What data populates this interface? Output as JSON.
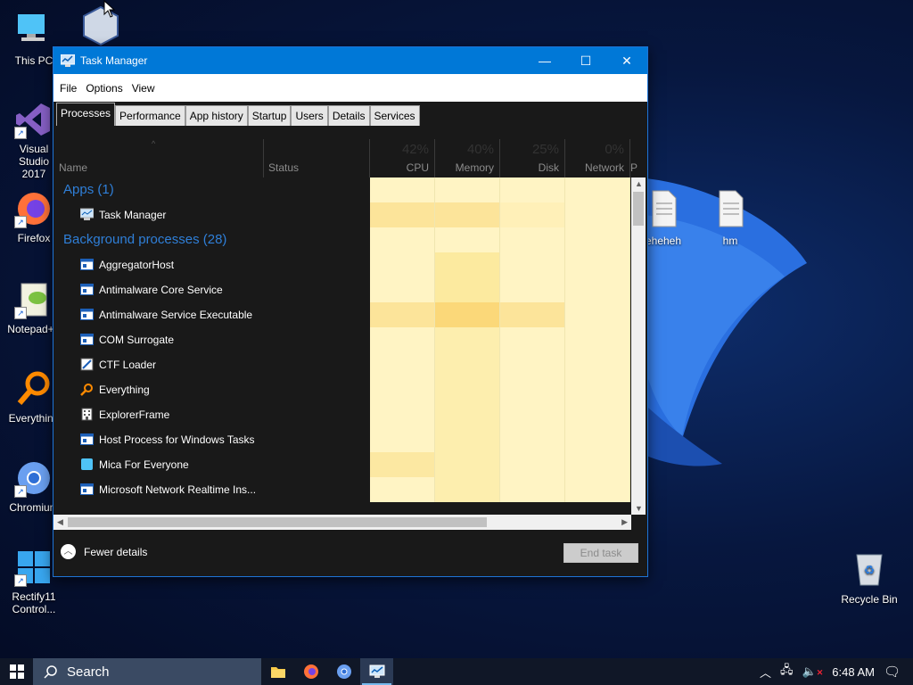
{
  "desktop": {
    "icons_left": [
      {
        "label": "This PC",
        "icon": "computer-icon"
      },
      {
        "label": "Visual Studio 2017",
        "icon": "visual-studio-icon"
      },
      {
        "label": "Firefox",
        "icon": "firefox-icon"
      },
      {
        "label": "Notepad++",
        "icon": "notepad-plus-icon"
      },
      {
        "label": "Everything",
        "icon": "everything-search-icon"
      },
      {
        "label": "Chromium",
        "icon": "chromium-icon"
      },
      {
        "label": "Rectify11 Control...",
        "icon": "windows-logo-icon"
      }
    ],
    "icons_right": [
      {
        "label": "eheheh",
        "icon": "text-file-icon"
      },
      {
        "label": "hm",
        "icon": "text-file-icon"
      },
      {
        "label": "Recycle Bin",
        "icon": "recycle-bin-icon"
      }
    ],
    "colors": {
      "wallpaper": "#07173f",
      "bloom": "#2a6fe0"
    }
  },
  "window": {
    "title": "Task Manager",
    "controls": {
      "minimize": "—",
      "maximize": "☐",
      "close": "✕"
    },
    "menu": [
      "File",
      "Options",
      "View"
    ],
    "tabs": [
      "Processes",
      "Performance",
      "App history",
      "Startup",
      "Users",
      "Details",
      "Services"
    ],
    "active_tab": "Processes",
    "columns": {
      "name": "Name",
      "status": "Status",
      "cpu": {
        "label": "CPU",
        "pct": "42%"
      },
      "memory": {
        "label": "Memory",
        "pct": "40%"
      },
      "disk": {
        "label": "Disk",
        "pct": "25%"
      },
      "network": {
        "label": "Network",
        "pct": "0%"
      },
      "power": "P"
    },
    "groups": {
      "apps": "Apps (1)",
      "background": "Background processes (28)"
    },
    "processes": [
      {
        "name": "Task Manager",
        "icon": "task-manager-icon",
        "group": "apps"
      },
      {
        "name": "AggregatorHost",
        "icon": "window-app-icon",
        "group": "background"
      },
      {
        "name": "Antimalware Core Service",
        "icon": "window-app-icon",
        "group": "background"
      },
      {
        "name": "Antimalware Service Executable",
        "icon": "window-app-icon",
        "group": "background"
      },
      {
        "name": "COM Surrogate",
        "icon": "window-app-icon",
        "group": "background"
      },
      {
        "name": "CTF Loader",
        "icon": "ctf-loader-icon",
        "group": "background"
      },
      {
        "name": "Everything",
        "icon": "everything-search-icon",
        "group": "background"
      },
      {
        "name": "ExplorerFrame",
        "icon": "building-icon",
        "group": "background"
      },
      {
        "name": "Host Process for Windows Tasks",
        "icon": "window-app-icon",
        "group": "background"
      },
      {
        "name": "Mica For Everyone",
        "icon": "mica-icon",
        "group": "background"
      },
      {
        "name": "Microsoft Network Realtime Ins...",
        "icon": "window-app-icon",
        "group": "background"
      }
    ],
    "footer": {
      "fewer_details": "Fewer details",
      "end_task": "End task"
    }
  },
  "taskbar": {
    "search_label": "Search",
    "pinned": [
      "file-explorer-icon",
      "firefox-icon",
      "chromium-icon",
      "task-manager-icon"
    ],
    "clock": "6:48 AM",
    "colors": {
      "bar": "#101727",
      "search": "#3a4a63",
      "accent": "#0078d7"
    }
  }
}
